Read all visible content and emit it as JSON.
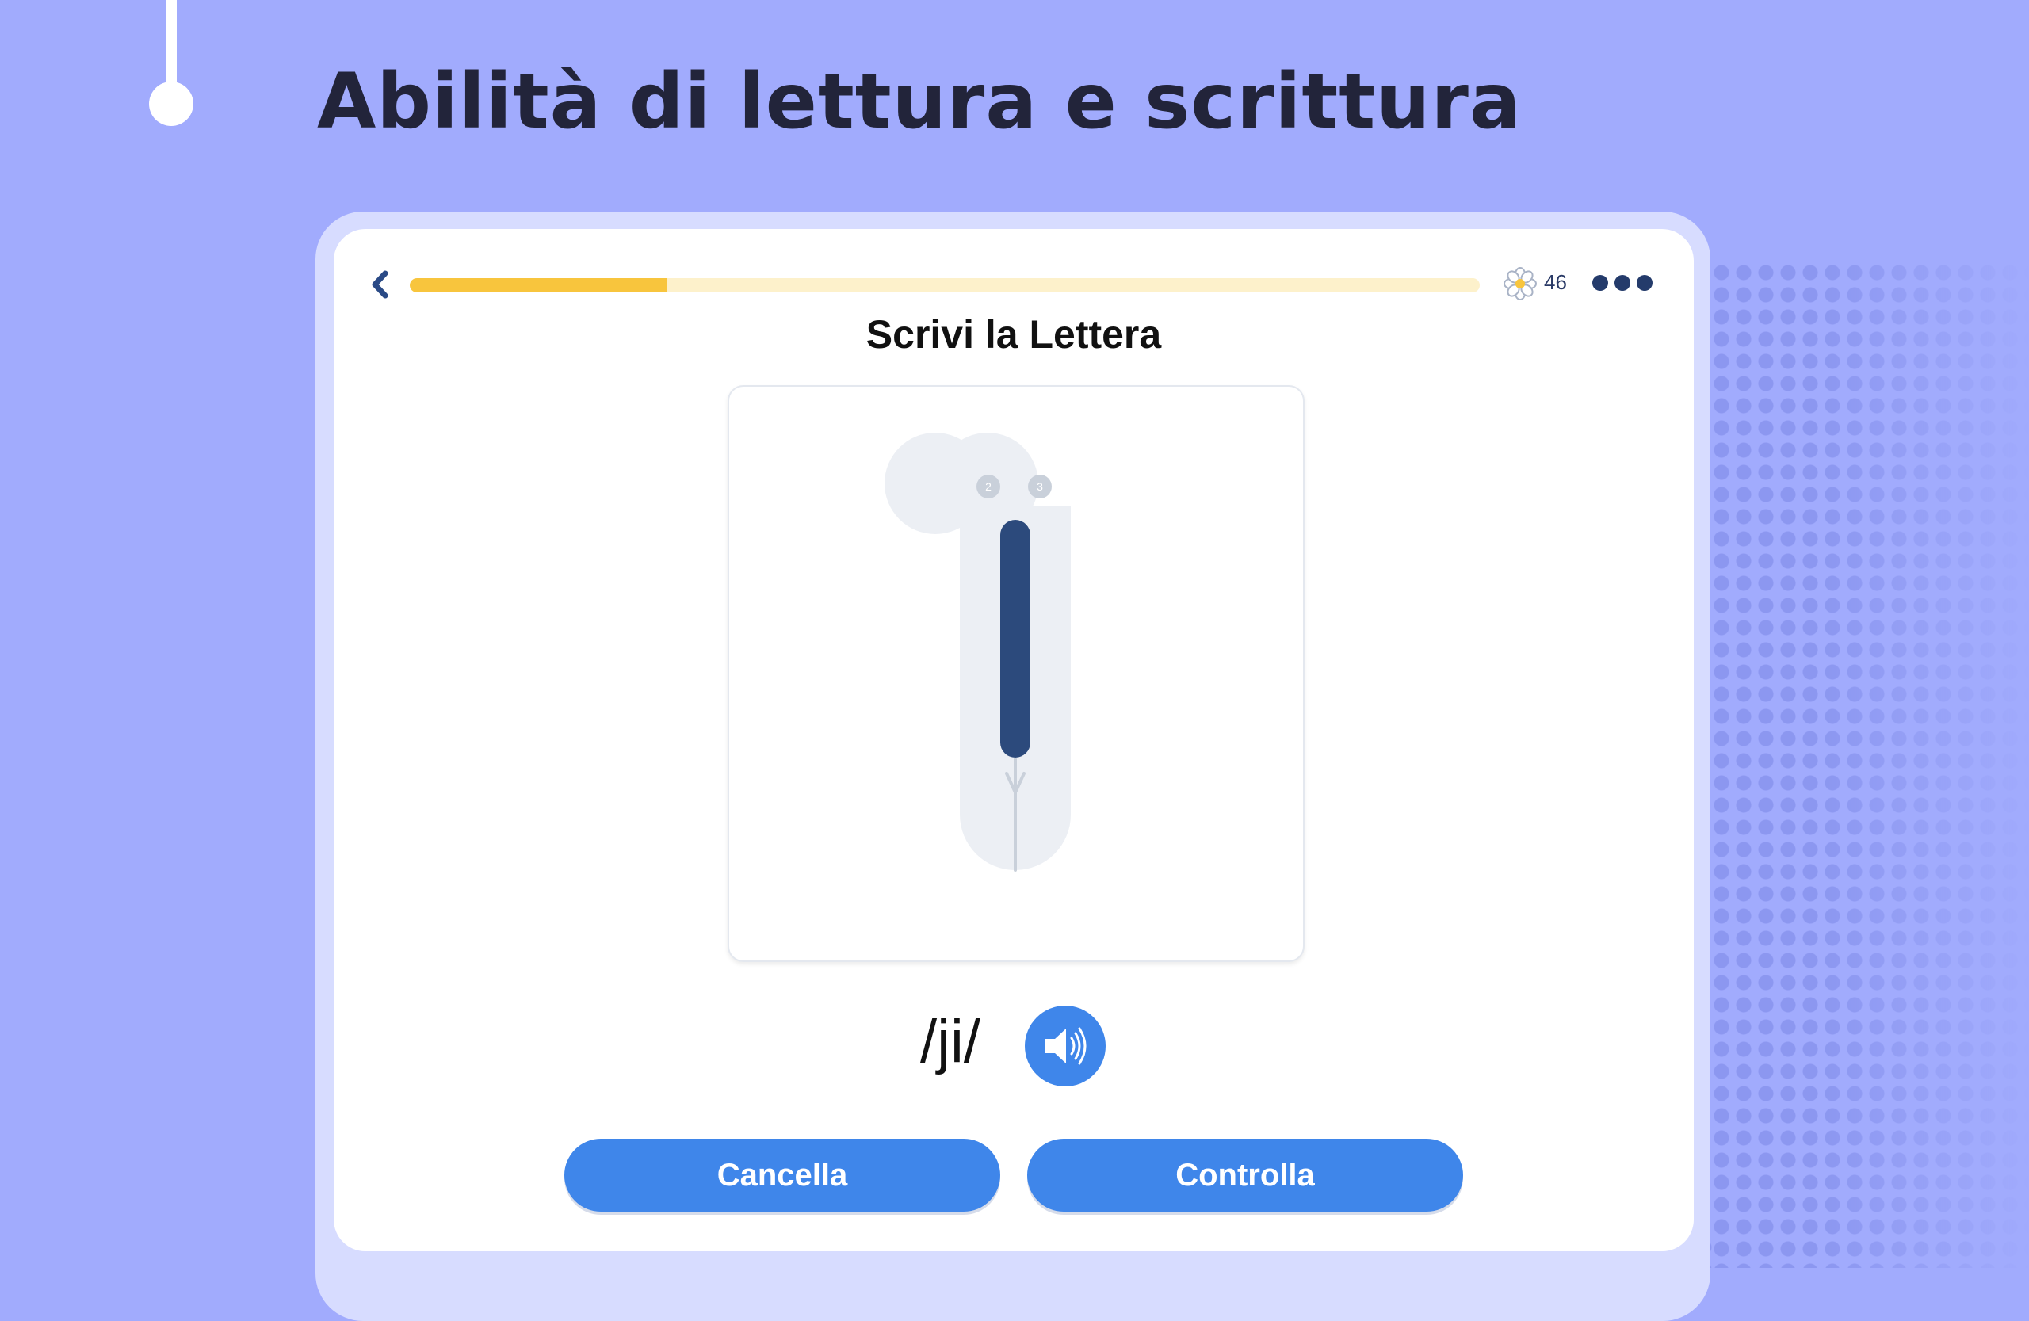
{
  "headline": "Abilità di lettura e scrittura",
  "header": {
    "progress_percent": 24,
    "points": "46",
    "back_icon": "chevron-left-icon",
    "points_icon": "flower-icon",
    "more_icon": "more-dots-icon"
  },
  "exercise": {
    "title": "Scrivi la Lettera",
    "stroke_numbers": [
      "2",
      "3"
    ],
    "phonetic": "/ji/",
    "audio_icon": "speaker-icon"
  },
  "buttons": {
    "cancel": "Cancella",
    "check": "Controlla"
  },
  "colors": {
    "background": "#a1abfd",
    "accent_blue": "#3f86ea",
    "progress_fill": "#f8c53d",
    "progress_track": "#fdf1cb",
    "stroke_dark": "#2c4a7c",
    "guide_light": "#eceff4"
  }
}
